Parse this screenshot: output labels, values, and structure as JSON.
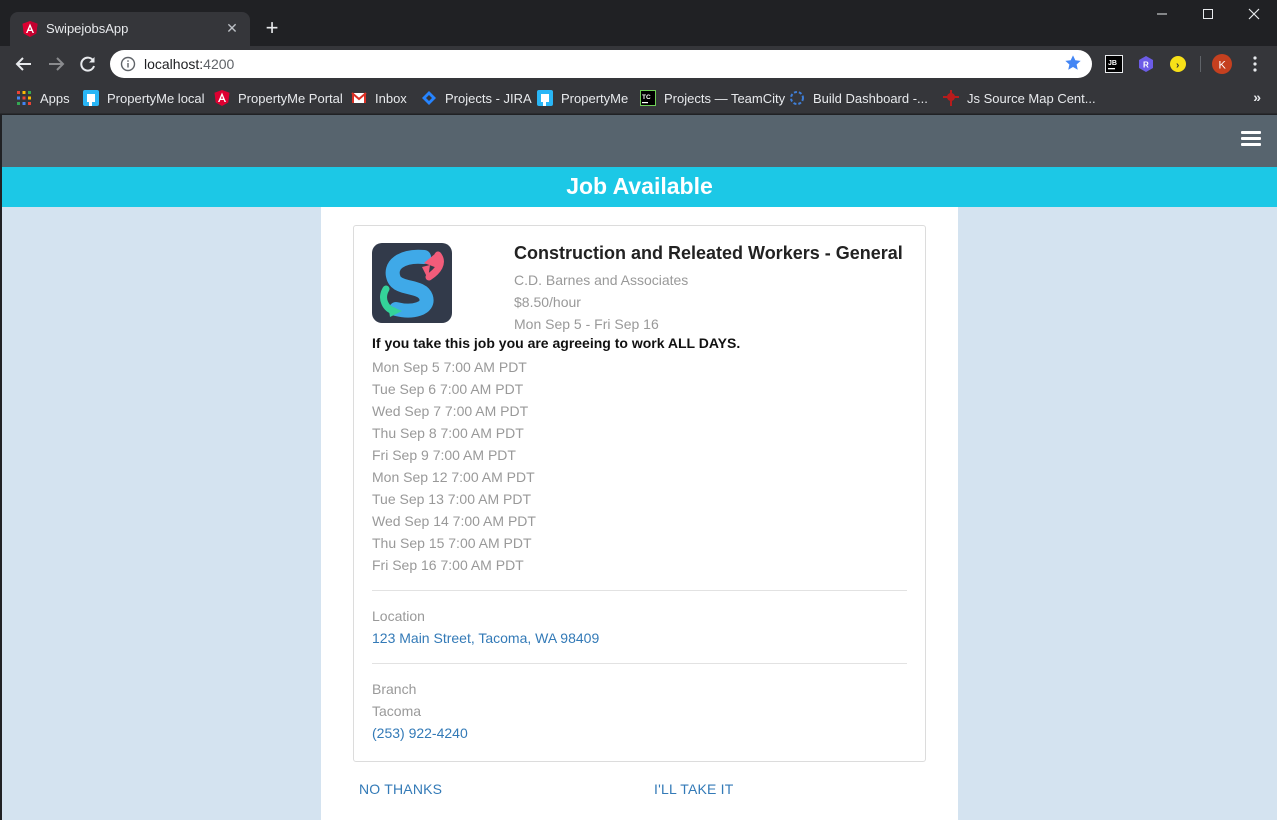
{
  "browser": {
    "tab_title": "SwipejobsApp",
    "new_tab_icon": "plus-icon",
    "url_host": "localhost:",
    "url_port": "4200",
    "bookmarks": [
      {
        "label": "Apps",
        "icon": "apps-grid-icon"
      },
      {
        "label": "PropertyMe local",
        "icon": "propertyme-icon"
      },
      {
        "label": "PropertyMe Portal",
        "icon": "angular-icon"
      },
      {
        "label": "Inbox",
        "icon": "gmail-icon"
      },
      {
        "label": "Projects - JIRA",
        "icon": "jira-icon"
      },
      {
        "label": "PropertyMe",
        "icon": "propertyme-icon"
      },
      {
        "label": "Projects — TeamCity",
        "icon": "teamcity-icon"
      },
      {
        "label": "Build Dashboard -...",
        "icon": "build-dashboard-icon"
      },
      {
        "label": "Js Source Map Cent...",
        "icon": "source-map-icon"
      }
    ],
    "bookmarks_more": "»",
    "extensions": [
      {
        "label": "JB",
        "icon": "jetbrains-icon"
      },
      {
        "label": "R",
        "icon": "redux-icon"
      },
      {
        "label": "›",
        "icon": "extension-yellow-icon"
      },
      {
        "label": "K",
        "icon": "profile-avatar-icon"
      }
    ]
  },
  "app": {
    "heading": "Job Available",
    "job": {
      "title": "Construction and Releated Workers - General",
      "company": "C.D. Barnes and Associates",
      "rate": "$8.50/hour",
      "date_range": "Mon Sep 5 - Fri Sep 16",
      "notice": "If you take this job you are agreeing to work ALL DAYS.",
      "shifts": [
        "Mon Sep 5 7:00 AM PDT",
        "Tue Sep 6 7:00 AM PDT",
        "Wed Sep 7 7:00 AM PDT",
        "Thu Sep 8 7:00 AM PDT",
        "Fri Sep 9 7:00 AM PDT",
        "Mon Sep 12 7:00 AM PDT",
        "Tue Sep 13 7:00 AM PDT",
        "Wed Sep 14 7:00 AM PDT",
        "Thu Sep 15 7:00 AM PDT",
        "Fri Sep 16 7:00 AM PDT"
      ],
      "location_label": "Location",
      "location_address": "123 Main Street, Tacoma, WA 98409",
      "branch_label": "Branch",
      "branch_name": "Tacoma",
      "branch_phone": "(253) 922-4240"
    },
    "actions": {
      "decline": "NO THANKS",
      "accept": "I'LL TAKE IT"
    }
  },
  "colors": {
    "appbar": "#57646e",
    "heading_band": "#1cc8e6",
    "page_bg": "#d4e3f0",
    "link": "#337ab7",
    "muted_text": "#999999"
  }
}
